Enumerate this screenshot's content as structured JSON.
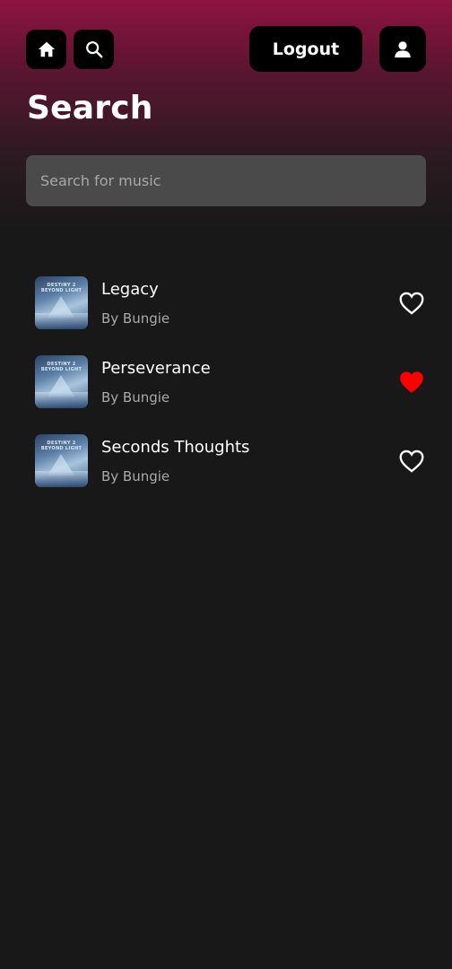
{
  "header": {
    "home_icon": "home-icon",
    "search_icon": "search-icon",
    "logout_label": "Logout",
    "profile_icon": "user-icon",
    "gradient_top": "#8e1340"
  },
  "page_title": "Search",
  "search": {
    "placeholder": "Search for music",
    "value": ""
  },
  "cover_text": "DESTINY 2 BEYOND LIGHT",
  "tracks": [
    {
      "title": "Legacy",
      "artist": "By Bungie",
      "liked": false
    },
    {
      "title": "Perseverance",
      "artist": "By Bungie",
      "liked": true
    },
    {
      "title": "Seconds Thoughts",
      "artist": "By Bungie",
      "liked": false
    }
  ],
  "colors": {
    "background": "#181818",
    "liked_heart": "#ff0000",
    "unliked_heart": "#ffffff"
  }
}
